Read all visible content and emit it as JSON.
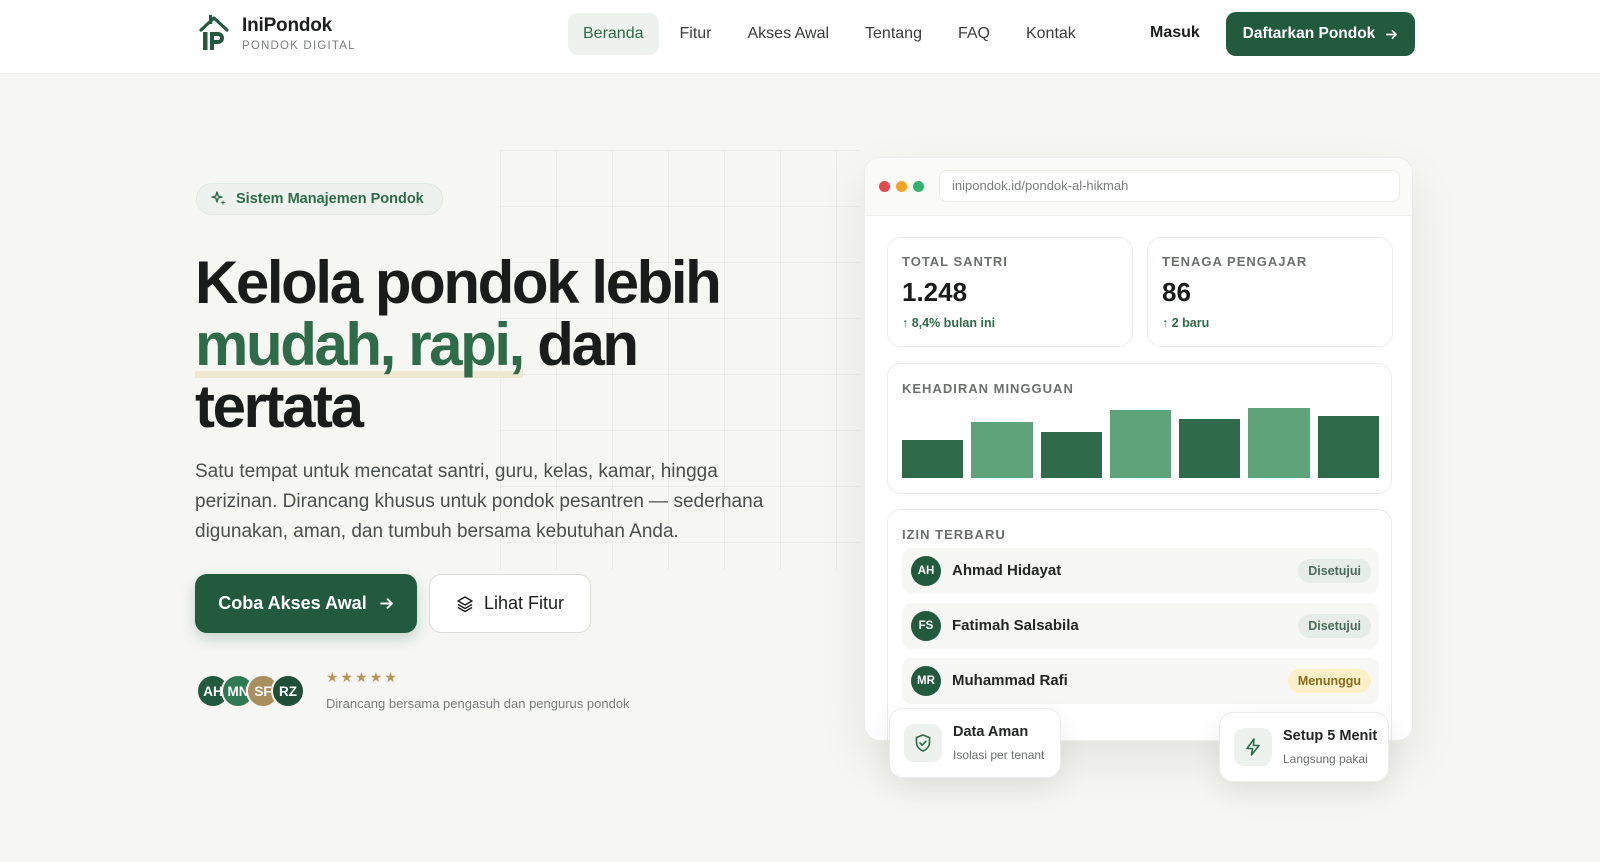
{
  "brand": {
    "name": "IniPondok",
    "tagline": "PONDOK DIGITAL",
    "color": "#225a3d"
  },
  "nav": {
    "links": [
      "Beranda",
      "Fitur",
      "Akses Awal",
      "Tentang",
      "FAQ",
      "Kontak"
    ],
    "active": "Beranda",
    "login": "Masuk",
    "cta": "Daftarkan Pondok"
  },
  "hero": {
    "badge": "Sistem Manajemen Pondok",
    "headline_1": "Kelola pondok lebih",
    "headline_accent": "mudah, rapi,",
    "headline_2": " dan",
    "headline_3": "tertata",
    "subcopy": "Satu tempat untuk mencatat santri, guru, kelas, kamar, hingga perizinan. Dirancang khusus untuk pondok pesantren — sederhana digunakan, aman, dan tumbuh bersama kebutuhan Anda.",
    "primary_cta": "Coba Akses Awal",
    "secondary_cta": "Lihat Fitur",
    "avatars": [
      "AH",
      "MN",
      "SF",
      "RZ"
    ],
    "stars": "★★★★★",
    "trust_text": "Dirancang bersama pengasuh dan pengurus pondok"
  },
  "dashboard": {
    "url": "inipondok.id/pondok-al-hikmah",
    "stats": [
      {
        "label": "TOTAL SANTRI",
        "value": "1.248",
        "delta": "↑ 8,4% bulan ini"
      },
      {
        "label": "TENAGA PENGAJAR",
        "value": "86",
        "delta": "↑ 2 baru"
      }
    ],
    "attendance": {
      "label": "KEHADIRAN MINGGUAN",
      "values": [
        0.55,
        0.8,
        0.66,
        0.97,
        0.84,
        1.0,
        0.88
      ],
      "colors": [
        "#2f6a4b",
        "#5ea37a",
        "#2f6a4b",
        "#5ea37a",
        "#2f6a4b",
        "#5ea37a",
        "#2f6a4b"
      ]
    },
    "permits": {
      "label": "IZIN TERBARU",
      "rows": [
        {
          "initials": "AH",
          "name": "Ahmad Hidayat",
          "status": "Disetujui",
          "state": "ok"
        },
        {
          "initials": "FS",
          "name": "Fatimah Salsabila",
          "status": "Disetujui",
          "state": "ok"
        },
        {
          "initials": "MR",
          "name": "Muhammad Rafi",
          "status": "Menunggu",
          "state": "wait"
        }
      ]
    }
  },
  "floats": {
    "secure": {
      "title": "Data Aman",
      "sub": "Isolasi per tenant",
      "icon": "shield-check-icon"
    },
    "setup": {
      "title": "Setup 5 Menit",
      "sub": "Langsung pakai",
      "icon": "lightning-icon"
    }
  }
}
